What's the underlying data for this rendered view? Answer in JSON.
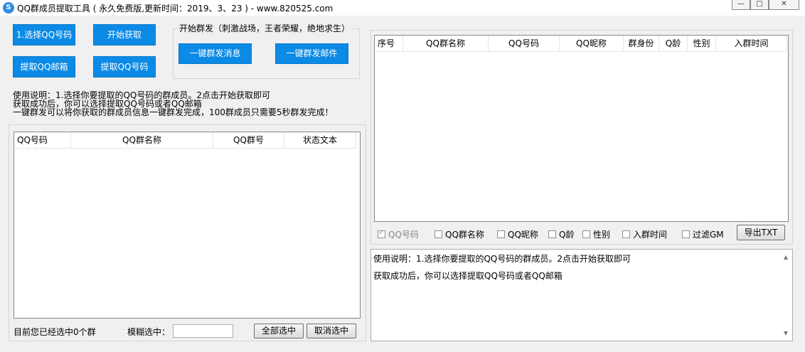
{
  "window": {
    "title": "QQ群成员提取工具 ( 永久免费版,更新时间：2019、3、23 )  - www.820525.com",
    "icon": "qq-logo-icon",
    "controls": {
      "minimize": "—",
      "maximize": "□",
      "close": "✕"
    }
  },
  "buttons": {
    "select_qq": "1.选择QQ号码",
    "start_fetch": "开始获取",
    "extract_email": "提取QQ邮箱",
    "extract_qq": "提取QQ号码",
    "send_message": "一键群发消息",
    "send_mail": "一键群发邮件",
    "select_all": "全部选中",
    "deselect": "取消选中",
    "export_txt": "导出TXT"
  },
  "group_send": {
    "title": "开始群发（刺激战场，王者荣耀，绝地求生）"
  },
  "instructions": [
    "使用说明：1.选择你要提取的QQ号码的群成员。2点击开始获取即可",
    "获取成功后，你可以选择提取QQ号码或者QQ邮箱",
    "一键群发可以将你获取的群成员信息一键群发完成，100群成员只需要5秒群发完成！"
  ],
  "groups_table": {
    "columns": [
      "QQ号码",
      "QQ群名称",
      "QQ群号",
      "状态文本"
    ],
    "rows": []
  },
  "bottom_left": {
    "selected_status": "目前您已经选中0个群",
    "fuzzy_label": "模糊选中：",
    "fuzzy_value": ""
  },
  "members_table": {
    "columns": [
      "序号",
      "QQ群名称",
      "QQ号码",
      "QQ昵称",
      "群身份",
      "Q龄",
      "性别",
      "入群时间"
    ],
    "rows": []
  },
  "export_options": [
    {
      "label": "QQ号码",
      "checked": true,
      "disabled": true
    },
    {
      "label": "QQ群名称",
      "checked": false,
      "disabled": false
    },
    {
      "label": "QQ昵称",
      "checked": false,
      "disabled": false
    },
    {
      "label": "Q龄",
      "checked": false,
      "disabled": false
    },
    {
      "label": "性别",
      "checked": false,
      "disabled": false
    },
    {
      "label": "入群时间",
      "checked": false,
      "disabled": false
    },
    {
      "label": "过滤GM",
      "checked": false,
      "disabled": false
    }
  ],
  "log": [
    "使用说明：1.选择你要提取的QQ号码的群成员。2点击开始获取即可",
    "获取成功后，你可以选择提取QQ号码或者QQ邮箱"
  ],
  "colors": {
    "accent_button": "#0b8ae6",
    "window_bg": "#f0f0f0"
  }
}
